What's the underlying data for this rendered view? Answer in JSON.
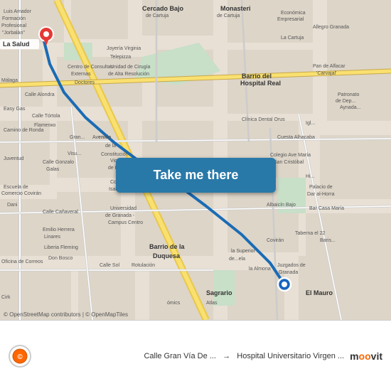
{
  "map": {
    "background_color": "#e8e0d5",
    "button_label": "Take me there",
    "button_color": "#2979a8"
  },
  "bottom_bar": {
    "attribution": "© OpenStreetMap contributors | © OpenMapTiles",
    "from_label": "Calle Gran Vía De ...",
    "to_label": "Hospital Universitario Virgen ...",
    "arrow": "→",
    "moovit_logo": "moovit"
  }
}
